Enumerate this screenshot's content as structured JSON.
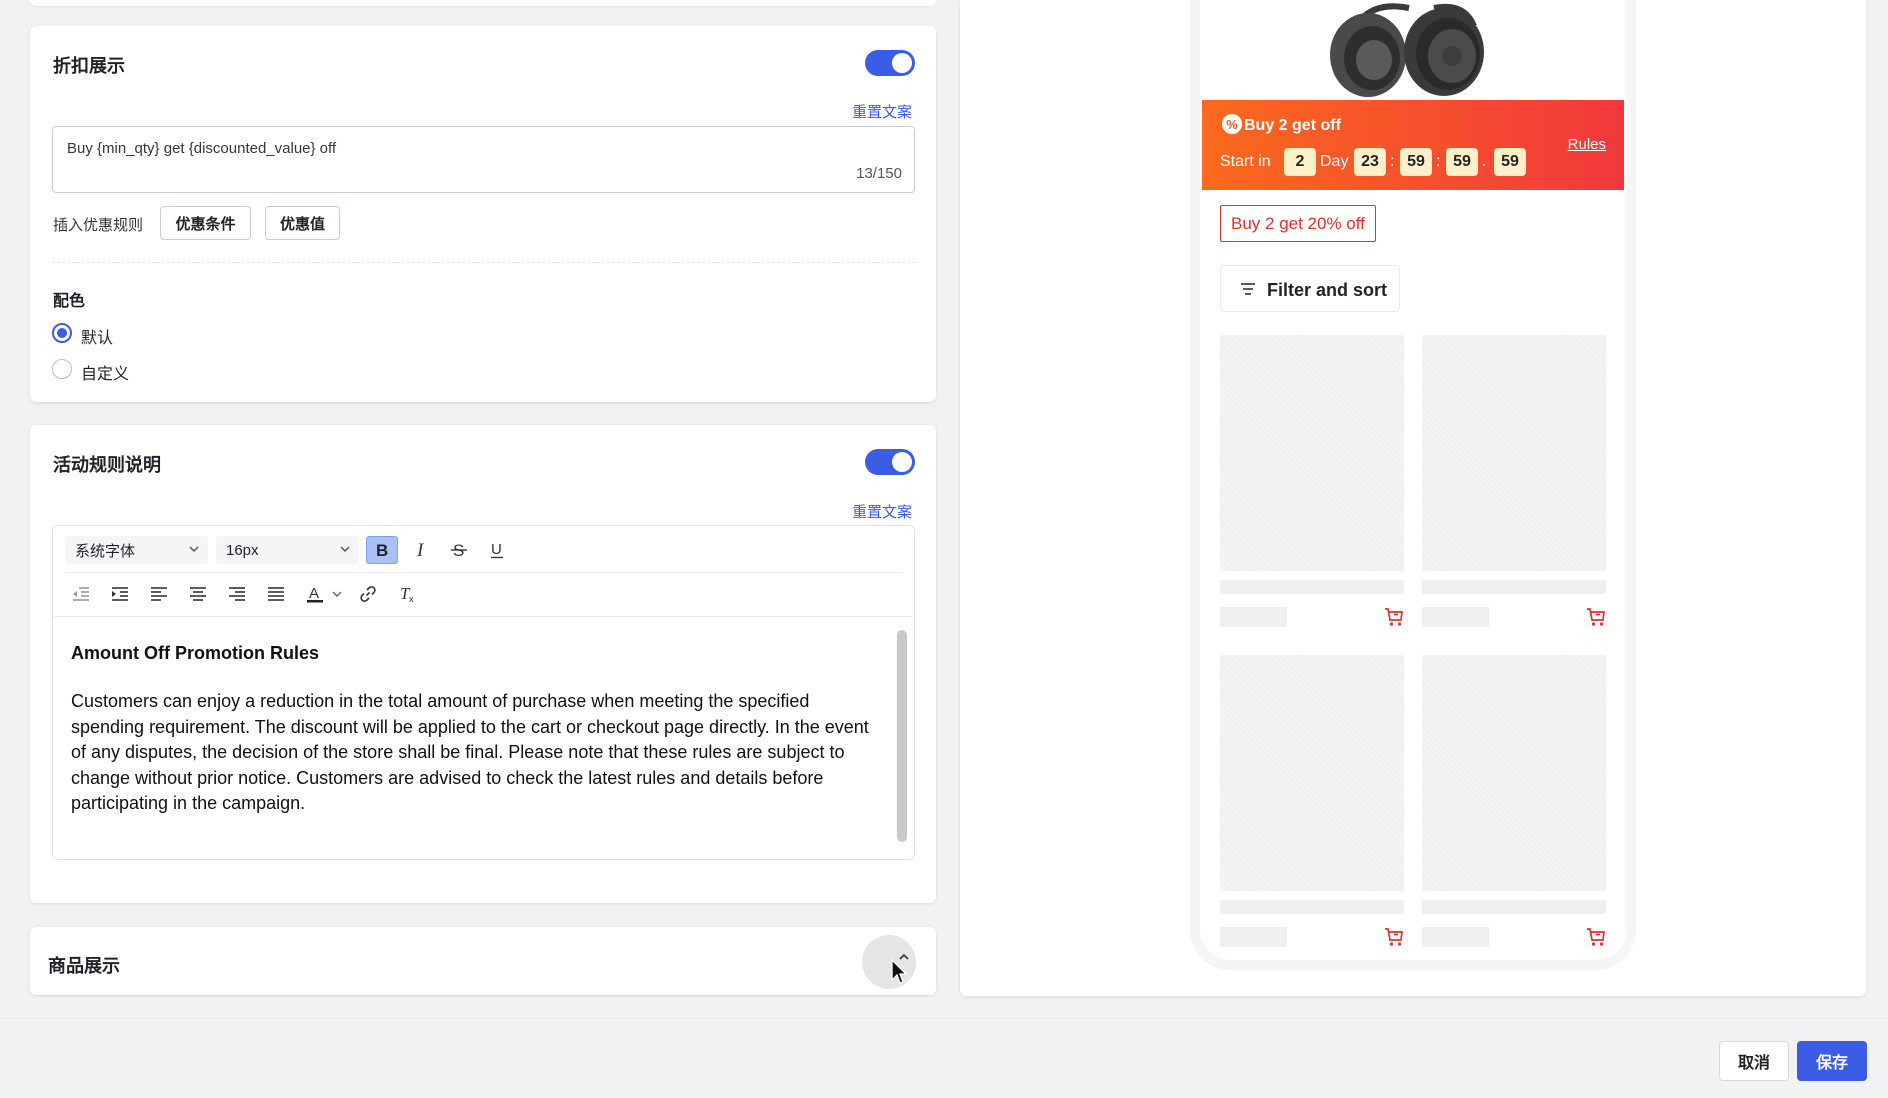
{
  "discount_display": {
    "title": "折扣展示",
    "toggle_on": true,
    "reset_label": "重置文案",
    "text_value": "Buy {min_qty} get {discounted_value} off",
    "char_count": "13/150",
    "insert_label": "插入优惠规则",
    "insert_buttons": [
      "优惠条件",
      "优惠值"
    ],
    "color_title": "配色",
    "color_options": [
      {
        "label": "默认",
        "selected": true
      },
      {
        "label": "自定义",
        "selected": false
      }
    ]
  },
  "rules_section": {
    "title": "活动规则说明",
    "toggle_on": true,
    "reset_label": "重置文案",
    "toolbar": {
      "font_family": "系统字体",
      "font_size": "16px"
    },
    "content_heading": "Amount Off Promotion Rules",
    "content_body": "Customers can enjoy a reduction in the total amount of purchase when meeting the specified spending requirement. The discount will be applied to the cart or checkout page directly. In the event of any disputes, the decision of the store shall be final. Please note that these rules are subject to change without prior notice. Customers are advised to check the latest rules and details before participating in the campaign."
  },
  "product_section": {
    "title": "商品展示"
  },
  "preview": {
    "banner_title": "Buy 2 get off",
    "start_in": "Start in",
    "countdown": {
      "days": "2",
      "day_label": "Day",
      "hours": "23",
      "minutes": "59",
      "seconds": "59",
      "fraction": "59"
    },
    "rules_link": "Rules",
    "promo_tag": "Buy 2 get 20% off",
    "filter_label": "Filter and sort",
    "banner_colors": [
      "#fb6a1d",
      "#f2383c"
    ]
  },
  "footer": {
    "cancel_label": "取消",
    "save_label": "保存"
  },
  "colors": {
    "accent": "#3b5ce4",
    "promo_red": "#e4312b"
  }
}
